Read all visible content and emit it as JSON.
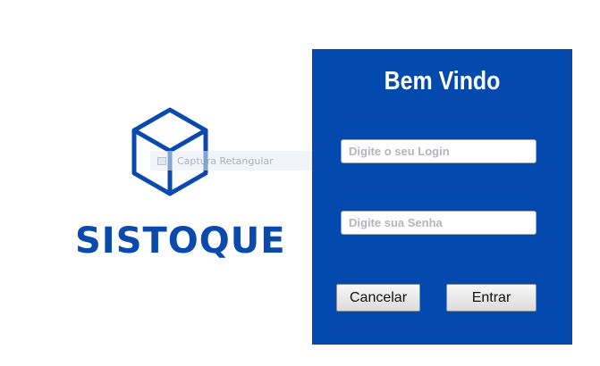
{
  "brand": {
    "name": "SISTOQUE",
    "logo_icon": "cube-icon",
    "color": "#0a4aad"
  },
  "ghost_tooltip": {
    "label": "Captura Retangular"
  },
  "login": {
    "title": "Bem Vindo",
    "panel_color": "#0449ad",
    "login_placeholder": "Digite o seu Login",
    "password_placeholder": "Digite sua Senha",
    "cancel_label": "Cancelar",
    "enter_label": "Entrar"
  }
}
